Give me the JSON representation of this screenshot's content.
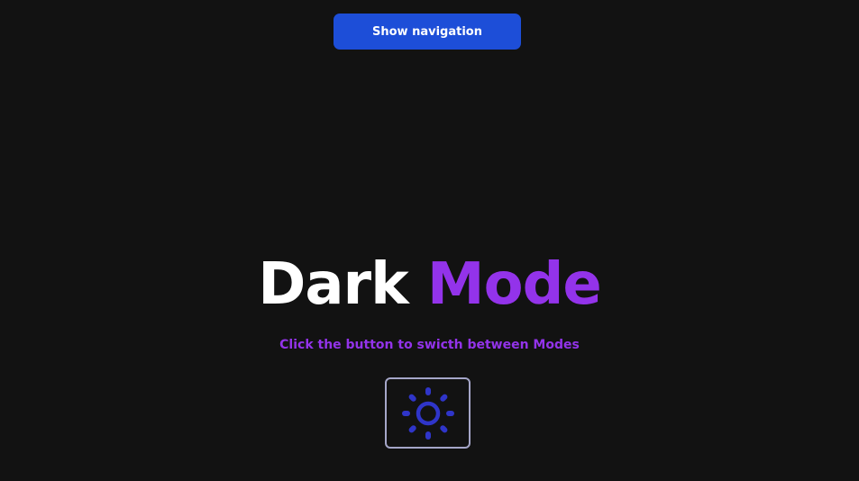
{
  "nav": {
    "button_label": "Show navigation"
  },
  "hero": {
    "title_part1": "Dark",
    "title_part2": "Mode",
    "subtitle": "Click the button to swicth between Modes"
  },
  "toggle": {
    "icon": "sun-icon"
  },
  "colors": {
    "background": "#121212",
    "nav_button": "#1d4ed8",
    "accent": "#9333ea",
    "icon": "#2f35c9",
    "toggle_border": "#a5a6c8"
  }
}
